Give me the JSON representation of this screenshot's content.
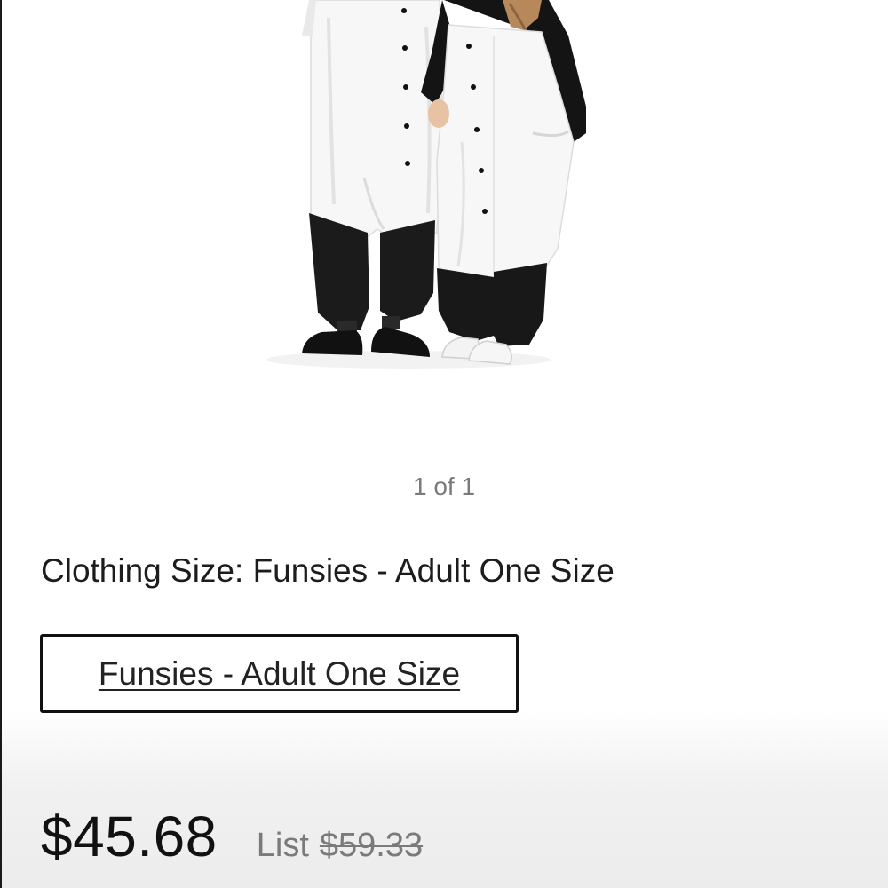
{
  "gallery": {
    "counter": "1 of 1",
    "image_icon": "product-photo-panda-onesie"
  },
  "variant": {
    "label": "Clothing Size: Funsies - Adult One Size",
    "selected_option": "Funsies - Adult One Size"
  },
  "pricing": {
    "price": "$45.68",
    "list_label": "List",
    "list_price": "$59.33"
  },
  "colors": {
    "text": "#1c1c1c",
    "muted": "#7a7a7a",
    "border": "#111111"
  }
}
